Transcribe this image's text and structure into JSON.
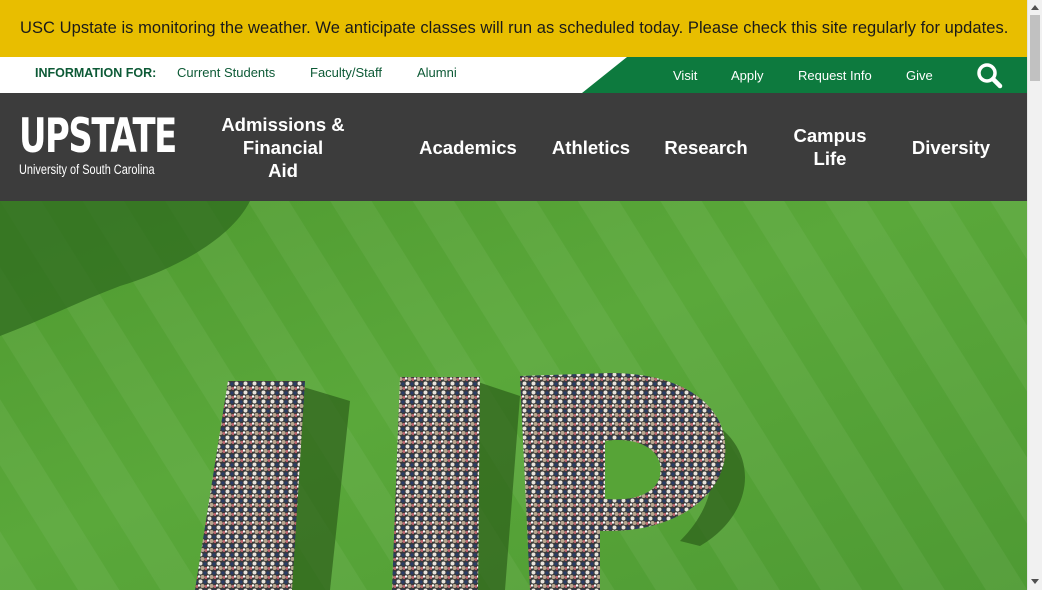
{
  "alert": {
    "text": "USC Upstate is monitoring the weather. We anticipate classes will run as scheduled today. Please check this site regularly for updates."
  },
  "utility": {
    "info_label": "INFORMATION FOR:",
    "audience_links": [
      "Current Students",
      "Faculty/Staff",
      "Alumni"
    ],
    "quick_links": [
      "Visit",
      "Apply",
      "Request Info",
      "Give"
    ],
    "search_icon": "search-icon"
  },
  "logo": {
    "name": "UPSTATE",
    "subtitle": "University of South Carolina"
  },
  "nav": {
    "items": [
      {
        "line1": "Admissions & Financial",
        "line2": "Aid"
      },
      {
        "line1": "Academics",
        "line2": ""
      },
      {
        "line1": "Athletics",
        "line2": ""
      },
      {
        "line1": "Research",
        "line2": ""
      },
      {
        "line1": "Campus",
        "line2": "Life"
      },
      {
        "line1": "Diversity",
        "line2": ""
      }
    ]
  },
  "hero": {
    "image": "aerial photo of students standing in the shape of the letters UP on a green lawn"
  },
  "colors": {
    "alert_bg": "#e8be00",
    "brand_green": "#0d7a3e",
    "dark_green_text": "#0d5a36",
    "nav_bg": "#3c3c3c"
  }
}
